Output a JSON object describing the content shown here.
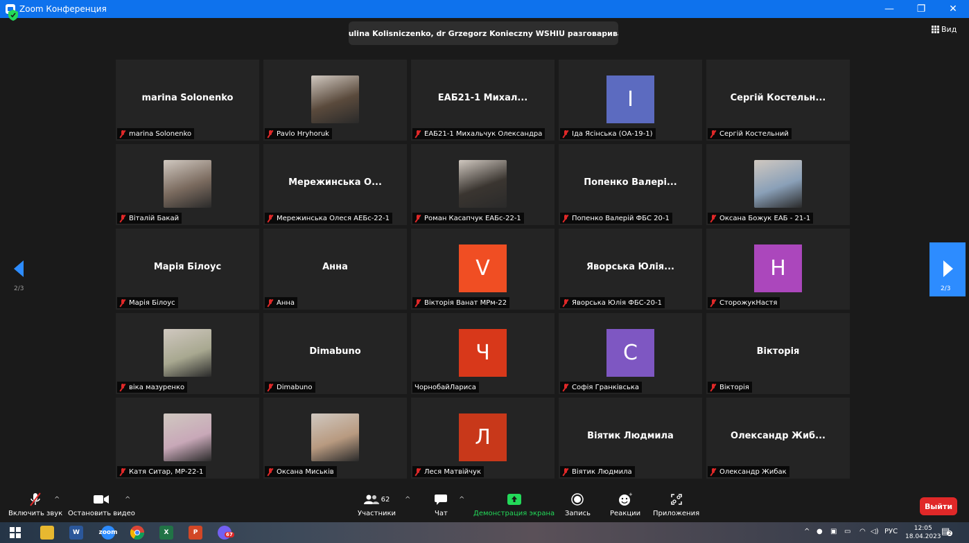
{
  "window": {
    "title": "Zoom Конференция",
    "minimize": "—",
    "restore": "❐",
    "close": "✕"
  },
  "topbar": {
    "speaking": "dr Paulina Kolisniczenko, dr Grzegorz Konieczny WSHIU разговаривает...",
    "view_label": "Вид"
  },
  "pagination": {
    "prev": "2/3",
    "next": "2/3"
  },
  "tiles": [
    {
      "big": "marina Solonenko",
      "label": "marina Solonenko",
      "muted": true
    },
    {
      "photo": "#5a4a3c",
      "label": "Pavlo Hryhoruk",
      "muted": true
    },
    {
      "big": "ЕАБ21-1 Михал...",
      "label": "ЕАБ21-1 Михальчук Олександра",
      "muted": true
    },
    {
      "initial": "I",
      "color": "#5c6bc0",
      "label": "Іда Ясінська (ОА-19-1)",
      "muted": true
    },
    {
      "big": "Сергій Костельн...",
      "label": "Сергій Костельний",
      "muted": true
    },
    {
      "photo": "#7a6a5e",
      "label": "Віталій Бакай",
      "muted": true
    },
    {
      "big": "Мережинська О...",
      "label": "Мережинська Олеся АЕБс-22-1",
      "muted": true
    },
    {
      "photo": "#3a3530",
      "label": "Роман Касапчук ЕАБс-22-1",
      "muted": true
    },
    {
      "big": "Попенко Валері...",
      "label": "Попенко Валерій ФБС 20-1",
      "muted": true
    },
    {
      "photo": "#8aa0b8",
      "label": "Оксана Божук ЕАБ - 21-1",
      "muted": true
    },
    {
      "big": "Марія Білоус",
      "label": "Марія Білоус",
      "muted": true
    },
    {
      "big": "Анна",
      "label": "Анна",
      "muted": true
    },
    {
      "initial": "V",
      "color": "#f04e23",
      "label": "Вікторія Ванат МРм-22",
      "muted": true
    },
    {
      "big": "Яворська Юлія...",
      "label": "Яворська Юлія ФБС-20-1",
      "muted": true
    },
    {
      "initial": "Н",
      "color": "#ab47bc",
      "label": "СторожукНастя",
      "muted": true
    },
    {
      "photo": "#a8a890",
      "label": "віка мазуренко",
      "muted": true
    },
    {
      "big": "Dimabuno",
      "label": "Dimabuno",
      "muted": true
    },
    {
      "initial": "Ч",
      "color": "#d8381a",
      "label": "ЧорнобайЛариса",
      "muted": false
    },
    {
      "initial": "С",
      "color": "#7e57c2",
      "label": "Софія Гранківська",
      "muted": true
    },
    {
      "big": "Вікторія",
      "label": "Вікторія",
      "muted": true
    },
    {
      "photo": "#c8a8b8",
      "label": "Катя Ситар, МР-22-1",
      "muted": true
    },
    {
      "photo": "#b89a80",
      "label": "Оксана Миськів",
      "muted": true
    },
    {
      "initial": "Л",
      "color": "#c8381a",
      "label": "Леся Матвійчук",
      "muted": true
    },
    {
      "big": "Віятик Людмила",
      "label": "Віятик Людмила",
      "muted": true
    },
    {
      "big": "Олександр Жиб...",
      "label": "Олександр Жибак",
      "muted": true
    }
  ],
  "toolbar": {
    "unmute_label": "Включить звук",
    "stop_video_label": "Остановить видео",
    "participants_label": "Участники",
    "participants_count": "62",
    "chat_label": "Чат",
    "share_label": "Демонстрация экрана",
    "record_label": "Запись",
    "reactions_label": "Реакции",
    "apps_label": "Приложения",
    "leave_label": "Выйти"
  },
  "taskbar": {
    "viber_badge": "67",
    "lang": "РУС",
    "time": "12:05",
    "date": "18.04.2023",
    "notifications": "2"
  },
  "colors": {
    "accent": "#2d8cff",
    "share_green": "#23d959",
    "leave_red": "#e02828",
    "mute_red": "#e02828"
  }
}
